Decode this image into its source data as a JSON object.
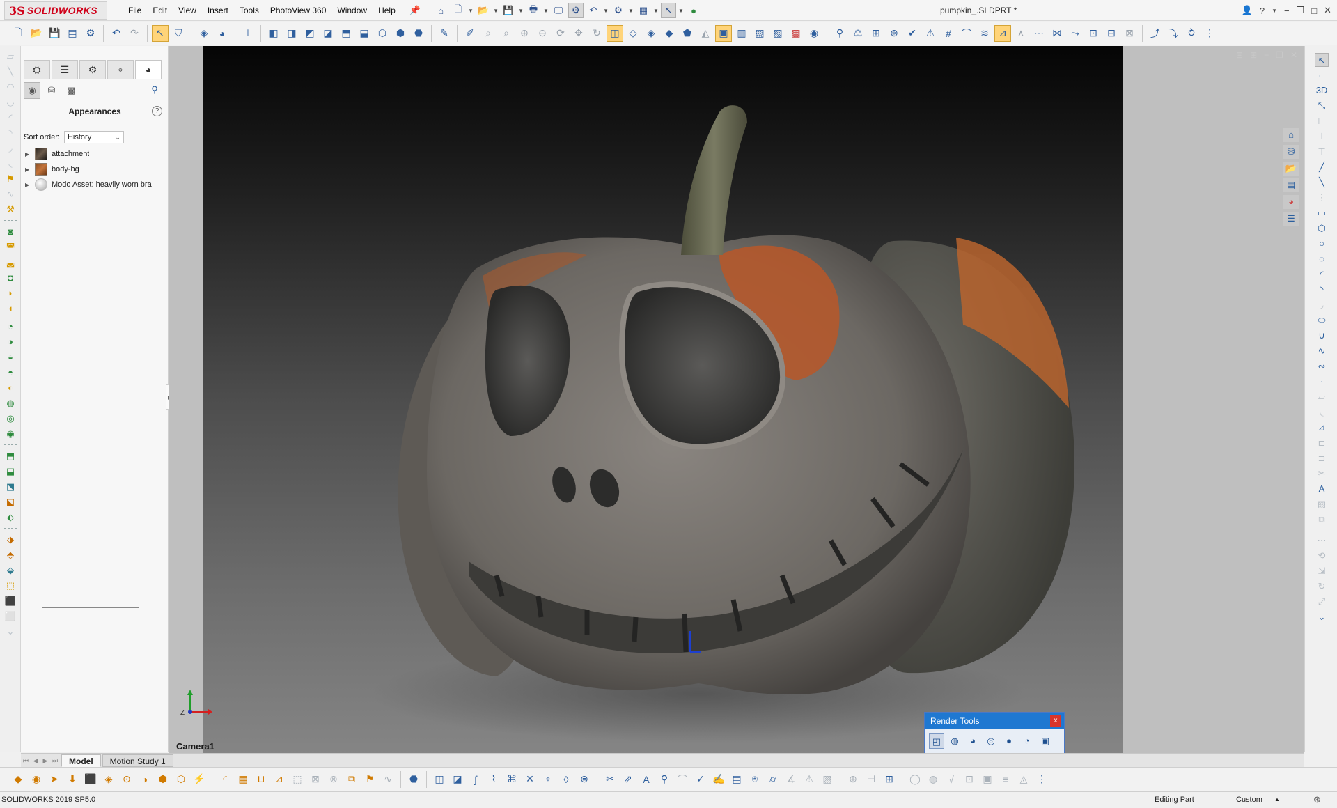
{
  "app": {
    "brand": "SOLIDWORKS",
    "brand_mark": "3S",
    "document_title": "pumpkin_.SLDPRT *"
  },
  "menu": [
    "File",
    "Edit",
    "View",
    "Insert",
    "Tools",
    "PhotoView 360",
    "Window",
    "Help"
  ],
  "quick_access_icons": [
    "home-icon",
    "new-document-icon",
    "open-icon",
    "save-icon",
    "print-icon",
    "screen-capture-icon",
    "rebuild-icon",
    "undo-icon",
    "options-icon",
    "fit-icon",
    "select-icon",
    "traffic-light-icon"
  ],
  "window_controls": [
    "user-icon",
    "help-icon",
    "minimize-icon",
    "restore-icon",
    "close-icon"
  ],
  "property_manager": {
    "tabs": [
      "feature-manager-icon",
      "property-manager-icon",
      "configuration-manager-icon",
      "dimxpert-icon",
      "display-manager-icon"
    ],
    "active_tab": 4,
    "sub_tabs": [
      "appearance-icon",
      "scene-icon",
      "decal-icon"
    ],
    "title": "Appearances",
    "help": "?",
    "sort_label": "Sort order:",
    "sort_value": "History",
    "appearances": [
      {
        "name": "attachment",
        "swatch": "sw-attach"
      },
      {
        "name": "body-bg",
        "swatch": "sw-body"
      },
      {
        "name": "Modo Asset: heavily worn bra",
        "swatch": "sw-modo"
      }
    ]
  },
  "viewport": {
    "camera_label": "Camera1",
    "triad_axis": "Z"
  },
  "render_tools": {
    "title": "Render Tools",
    "close": "x",
    "icons": [
      "preview-window-icon",
      "integrated-preview-icon",
      "final-render-icon",
      "render-region-icon",
      "options-icon",
      "schedule-render-icon",
      "recall-render-icon"
    ]
  },
  "bottom_tabs": {
    "tabs": [
      "Model",
      "Motion Study 1"
    ],
    "active": 0
  },
  "status": {
    "version": "SOLIDWORKS 2019 SP5.0",
    "mode": "Editing Part",
    "units": "Custom"
  },
  "colors": {
    "brand_red": "#d0021b",
    "accent_blue": "#1f78d1",
    "close_red": "#d9342b",
    "pumpkin_orange": "#c8672c",
    "pumpkin_grey": "#7b7670"
  }
}
